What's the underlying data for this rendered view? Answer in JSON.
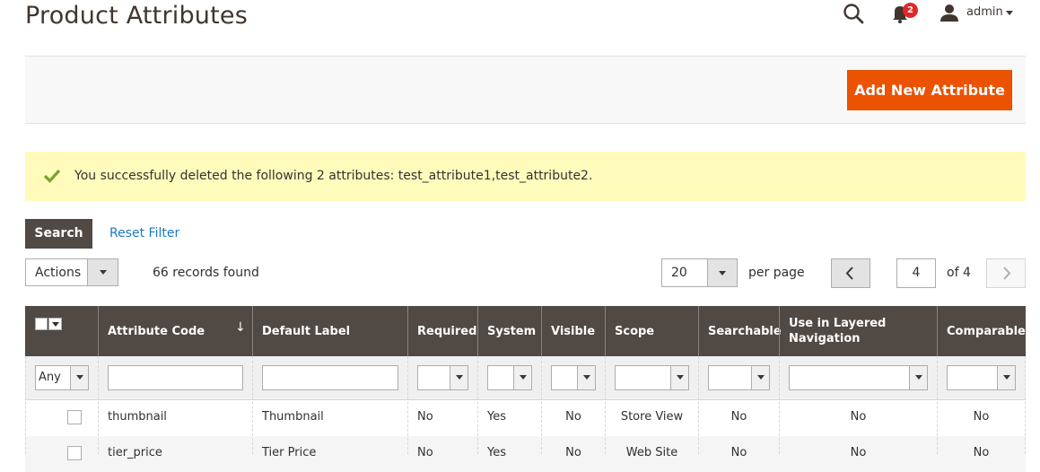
{
  "header": {
    "title": "Product Attributes",
    "notifications_count": "2",
    "user": "admin"
  },
  "page_actions": {
    "add_button": "Add New Attribute"
  },
  "message": {
    "text": "You successfully deleted the following 2 attributes: test_attribute1,test_attribute2."
  },
  "toolbar": {
    "search": "Search",
    "reset_filter": "Reset Filter",
    "actions": "Actions",
    "records_found": "66 records found",
    "per_page_value": "20",
    "per_page_label": "per page",
    "current_page": "4",
    "of_pages": "of 4"
  },
  "grid": {
    "columns": [
      "Attribute Code",
      "Default Label",
      "Required",
      "System",
      "Visible",
      "Scope",
      "Searchable",
      "Use in Layered Navigation",
      "Comparable"
    ],
    "filters": {
      "any": "Any"
    },
    "rows": [
      [
        "thumbnail",
        "Thumbnail",
        "No",
        "Yes",
        "No",
        "Store View",
        "No",
        "No",
        "No"
      ],
      [
        "tier_price",
        "Tier Price",
        "No",
        "Yes",
        "No",
        "Web Site",
        "No",
        "No",
        "No"
      ]
    ]
  },
  "colors": {
    "accent": "#eb5202",
    "header_bg": "#514943",
    "message_bg": "#fffbbb",
    "link": "#1979c3",
    "badge": "#e22626"
  }
}
